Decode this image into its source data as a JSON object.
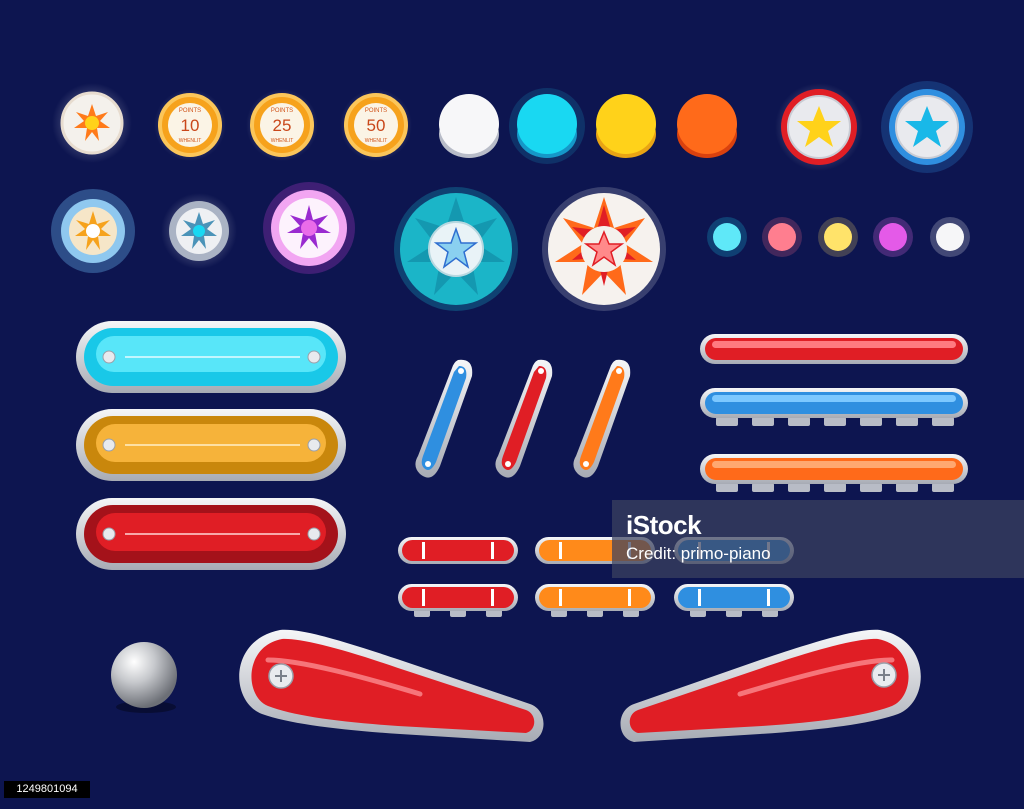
{
  "score_bumpers": [
    {
      "points_label": "POINTS",
      "value": "10",
      "sub_label": "WHENLIT"
    },
    {
      "points_label": "POINTS",
      "value": "25",
      "sub_label": "WHENLIT"
    },
    {
      "points_label": "POINTS",
      "value": "50",
      "sub_label": "WHENLIT"
    }
  ],
  "watermark": {
    "brand": "iStock",
    "credit": "Credit: primo-piano"
  },
  "stock_id": "1249801094",
  "colors": {
    "background": "#0d1550",
    "red": "#e01e25",
    "orange": "#ff6a1a",
    "amber": "#f6a21c",
    "yellow": "#ffd21a",
    "cyan": "#19d8f2",
    "blue": "#2f8fe0",
    "white": "#f4f4f6",
    "magenta": "#d33ee0",
    "pink": "#ff6a8a",
    "chrome": "#d7dae2"
  }
}
